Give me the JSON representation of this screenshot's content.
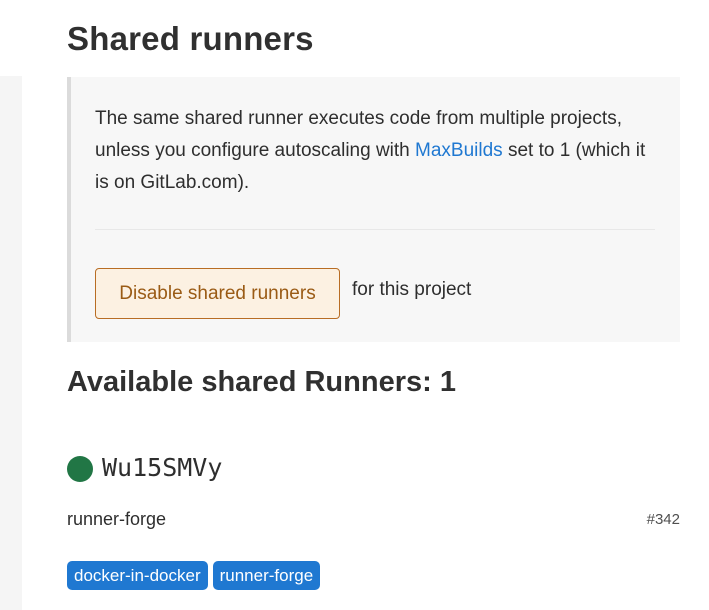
{
  "page_title": "Shared runners",
  "info": {
    "text_before": "The same shared runner executes code from multiple projects, unless you configure autoscaling with ",
    "link_text": "MaxBuilds",
    "text_after": " set to 1 (which it is on GitLab.com)."
  },
  "actions": {
    "disable_label": "Disable shared runners",
    "suffix": "for this project"
  },
  "available": {
    "title": "Available shared Runners: 1"
  },
  "runners": [
    {
      "token": "Wu15SMVy",
      "status_color": "#217645",
      "description": "runner-forge",
      "id_label": "#342",
      "tags": [
        "docker-in-docker",
        "runner-forge"
      ]
    }
  ],
  "colors": {
    "link": "#1f78d1",
    "tag_bg": "#1f78d1",
    "warning_bg": "#fcf1e2",
    "warning_border": "#b86d24"
  }
}
